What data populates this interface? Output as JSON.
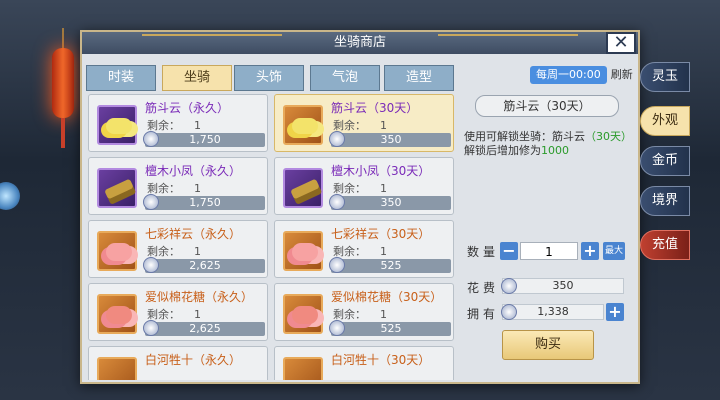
{
  "window": {
    "title": "坐骑商店",
    "close_label": "✕"
  },
  "tabs": [
    {
      "label": "时装",
      "active": false
    },
    {
      "label": "坐骑",
      "active": true
    },
    {
      "label": "头饰",
      "active": false
    },
    {
      "label": "气泡",
      "active": false
    },
    {
      "label": "造型",
      "active": false
    }
  ],
  "weekly": {
    "badge": "每周一00:00",
    "refresh": "刷新"
  },
  "items": [
    {
      "name": "筋斗云（永久）",
      "remain_label": "剩余：",
      "remain": "1",
      "price": "1,750"
    },
    {
      "name": "筋斗云（30天）",
      "remain_label": "剩余：",
      "remain": "1",
      "price": "350"
    },
    {
      "name": "檀木小凤（永久）",
      "remain_label": "剩余：",
      "remain": "1",
      "price": "1,750"
    },
    {
      "name": "檀木小凤（30天）",
      "remain_label": "剩余：",
      "remain": "1",
      "price": "350"
    },
    {
      "name": "七彩祥云（永久）",
      "remain_label": "剩余：",
      "remain": "1",
      "price": "2,625"
    },
    {
      "name": "七彩祥云（30天）",
      "remain_label": "剩余：",
      "remain": "1",
      "price": "525"
    },
    {
      "name": "爱似棉花糖（永久）",
      "remain_label": "剩余：",
      "remain": "1",
      "price": "2,625"
    },
    {
      "name": "爱似棉花糖（30天）",
      "remain_label": "剩余：",
      "remain": "1",
      "price": "525"
    },
    {
      "name": "白河牲十（永久）",
      "remain_label": "",
      "remain": "",
      "price": ""
    },
    {
      "name": "白河牲十（30天）",
      "remain_label": "",
      "remain": "",
      "price": ""
    }
  ],
  "detail": {
    "title": "筋斗云（30天）",
    "unlock_prefix": "使用可解锁坐骑：筋斗云",
    "unlock_duration": "（30天）",
    "bonus_prefix": "解锁后增加修为",
    "bonus_value": "1000"
  },
  "purchase": {
    "qty_label": "数量",
    "qty_value": "1",
    "minus": "−",
    "plus": "+",
    "max_label": "最大",
    "cost_label": "花费",
    "cost_value": "350",
    "own_label": "拥有",
    "own_value": "1,338",
    "buy_label": "购买"
  },
  "side_tabs": [
    {
      "label": "灵玉"
    },
    {
      "label": "外观"
    },
    {
      "label": "金币"
    },
    {
      "label": "境界"
    },
    {
      "label": "充值"
    }
  ]
}
